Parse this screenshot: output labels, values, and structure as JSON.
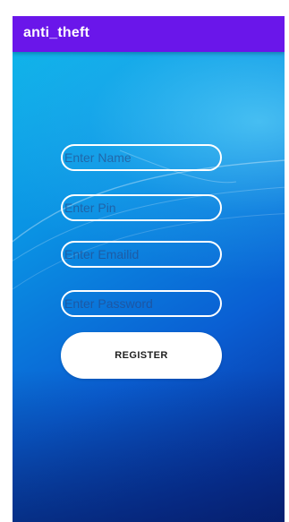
{
  "app_bar": {
    "title": "anti_theft",
    "color": "#6a16ea"
  },
  "form": {
    "name_placeholder": "Enter Name",
    "pin_placeholder": "Enter Pin",
    "email_placeholder": "Enter Emailid",
    "password_placeholder": "Enter Password",
    "register_label": "REGISTER"
  }
}
